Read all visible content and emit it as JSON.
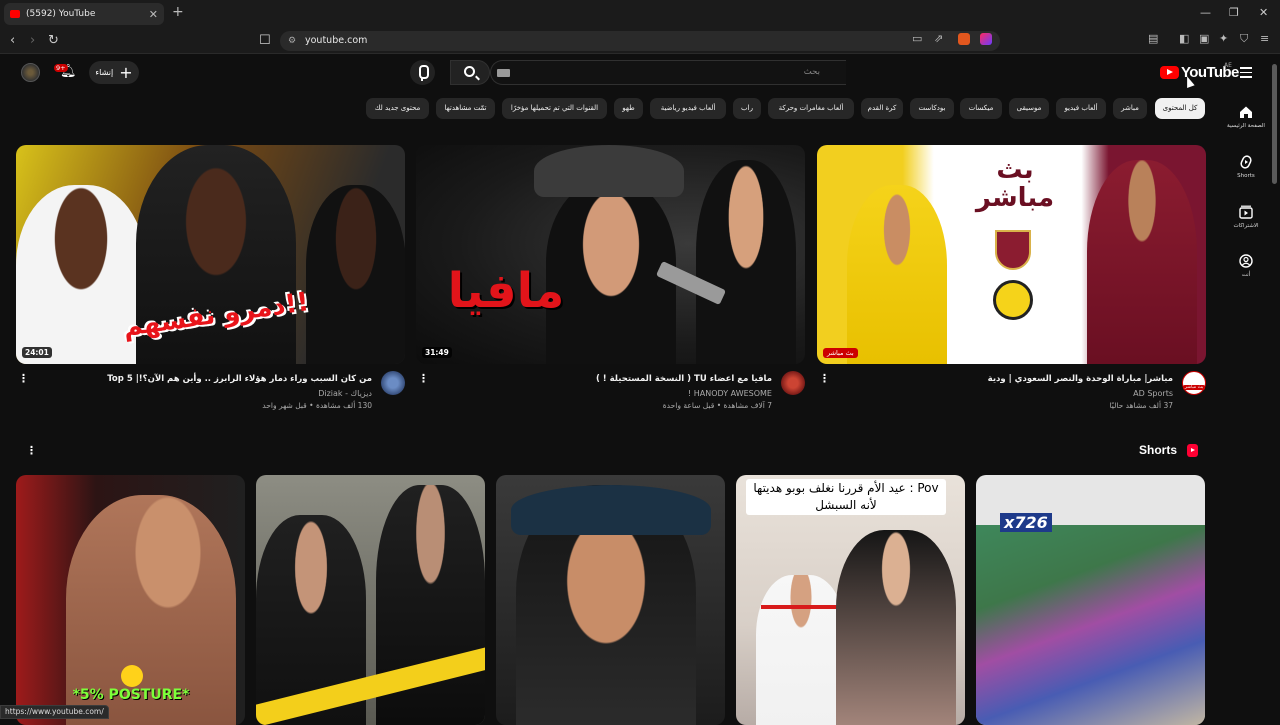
{
  "browser": {
    "tab_title": "(5592) YouTube",
    "new_tab": "+",
    "url": "youtube.com",
    "status_url": "https://www.youtube.com/"
  },
  "header": {
    "logo_text": "YouTube",
    "country_code": "AE",
    "search_placeholder": "بحث",
    "create_label": "إنشاء",
    "notif_count": "9+"
  },
  "chips": [
    "كل المحتوى",
    "مباشر",
    "ألعاب فيديو",
    "موسيقى",
    "ميكسات",
    "بودكاست",
    "كرة القدم",
    "ألعاب مغامرات وحركة",
    "راب",
    "ألعاب فيديو رياضية",
    "طهو",
    "القنوات التي تم تحميلها مؤخرًا",
    "تمّت مشاهدتها",
    "محتوى جديد لك"
  ],
  "sidebar": [
    {
      "label": "الصفحة الرئيسية",
      "icon": "home-icon"
    },
    {
      "label": "Shorts",
      "icon": "shorts-icon"
    },
    {
      "label": "الاشتراكات",
      "icon": "subscriptions-icon"
    },
    {
      "label": "أنت",
      "icon": "you-icon"
    }
  ],
  "videos": [
    {
      "title": "مباشر| مباراة الوحدة والنصر السعودي | ودية",
      "channel": "AD Sports",
      "stats": "37 ألف مشاهد حاليًا",
      "badge": "بث مباشر",
      "thumb_text_1": "بث",
      "thumb_text_2": "مباشر",
      "avatar_label": "بث مباشر"
    },
    {
      "title": "مافيا مع اعضاء TU ( النسخة المستحيلة ! )",
      "channel": "HANODY AWESOME !",
      "stats": "7 آلاف مشاهدة • قبل ساعة واحدة",
      "duration": "31:49",
      "thumb_text": "مافيا"
    },
    {
      "title": "من كان السبب وراء دمار هؤلاء الرابرز .. وأين هم الآن؟!| Top 5",
      "channel": "ديزياك - Diziak",
      "stats": "130 ألف مشاهدة • قبل شهر واحد",
      "duration": "24:01",
      "thumb_text": "دمرو نفسهم!!"
    }
  ],
  "shorts": {
    "heading": "Shorts",
    "items": [
      {
        "overlay": "*5% POSTURE*"
      },
      {
        "overlay": ""
      },
      {
        "overlay": ""
      },
      {
        "overlay": "Pov : عيد الأم قررنا نغلف بوبو هديتها لأنه السبشل"
      },
      {
        "overlay": "x726"
      }
    ]
  },
  "colors": {
    "background": "#0f0f0f",
    "chip": "#272727",
    "brand_red": "#ff0000",
    "live_red": "#cc0000"
  }
}
